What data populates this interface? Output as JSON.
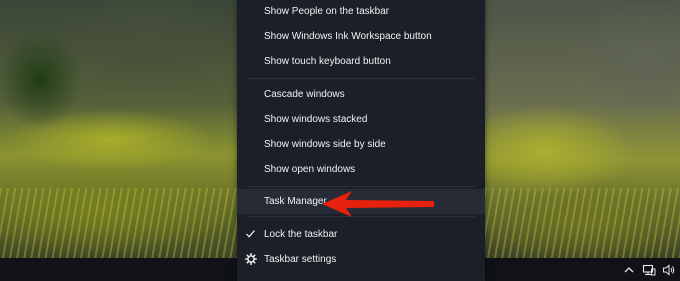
{
  "context_menu": {
    "items": [
      {
        "label": "Show People on the taskbar"
      },
      {
        "label": "Show Windows Ink Workspace button"
      },
      {
        "label": "Show touch keyboard button"
      },
      {
        "label": "Cascade windows"
      },
      {
        "label": "Show windows stacked"
      },
      {
        "label": "Show windows side by side"
      },
      {
        "label": "Show open windows"
      },
      {
        "label": "Task Manager"
      },
      {
        "label": "Lock the taskbar",
        "checked": true,
        "icon": "check-icon"
      },
      {
        "label": "Taskbar settings",
        "icon": "gear-icon"
      }
    ],
    "highlighted": "Task Manager"
  },
  "annotation": {
    "arrow_color": "#e8210e",
    "points_to": "Task Manager"
  },
  "system_tray": {
    "icons": [
      "chevron-up-icon",
      "network-icon",
      "volume-icon"
    ]
  },
  "colors": {
    "menu_background": "#1b1f28",
    "menu_text": "#f2f2f2",
    "taskbar": "#101218"
  }
}
